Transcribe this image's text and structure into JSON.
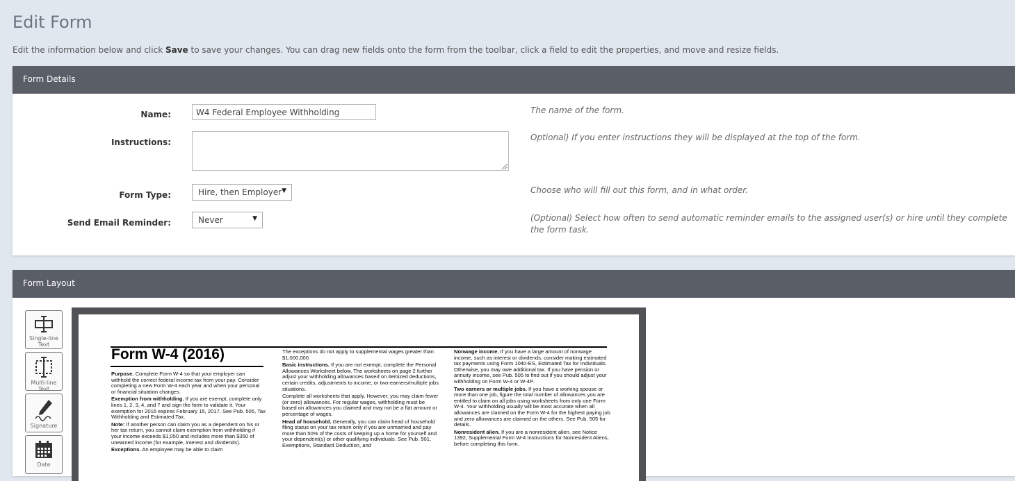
{
  "page": {
    "title": "Edit Form",
    "intro_before": "Edit the information below and click ",
    "intro_bold": "Save",
    "intro_after": " to save your changes. You can drag new fields onto the form from the toolbar, click a field to edit the properties, and move and resize fields."
  },
  "details": {
    "header": "Form Details",
    "name_label": "Name:",
    "name_value": "W4 Federal Employee Withholding",
    "name_help": "The name of the form.",
    "instructions_label": "Instructions:",
    "instructions_value": "",
    "instructions_help": "Optional) If you enter instructions they will be displayed at the top of the form.",
    "form_type_label": "Form Type:",
    "form_type_value": "Hire, then Employer",
    "form_type_help": "Choose who will fill out this form, and in what order.",
    "reminder_label": "Send Email Reminder:",
    "reminder_value": "Never",
    "reminder_help": "(Optional) Select how often to send automatic reminder emails to the assigned user(s) or hire until they complete the form task."
  },
  "layout": {
    "header": "Form Layout",
    "tools": [
      {
        "label_line1": "Single-line",
        "label_line2": "Text",
        "icon": "single-line-text-icon"
      },
      {
        "label_line1": "Multi-line",
        "label_line2": "Text",
        "icon": "multi-line-text-icon"
      },
      {
        "label_line1": "Signature",
        "label_line2": "",
        "icon": "signature-icon"
      },
      {
        "label_line1": "Date",
        "label_line2": "",
        "icon": "calendar-icon"
      }
    ]
  },
  "document": {
    "title": "Form W-4 (2016)",
    "col1": [
      {
        "bold": "Purpose.",
        "text": " Complete Form W-4 so that your employer can withhold the correct federal income tax from your pay. Consider completing a new Form W-4 each year and when your personal or financial situation changes."
      },
      {
        "bold": "Exemption from withholding.",
        "text": " If you are exempt, complete only lines 1, 2, 3, 4, and 7 and sign the form to validate it. Your exemption for 2016 expires February 15, 2017. See Pub. 505, Tax Withholding and Estimated Tax."
      },
      {
        "bold": "Note:",
        "text": " If another person can claim you as a dependent on his or her tax return, you cannot claim exemption from withholding if your income exceeds $1,050 and includes more than $350 of unearned income (for example, interest and dividends)."
      },
      {
        "bold": "Exceptions.",
        "text": " An employee may be able to claim"
      }
    ],
    "col2": [
      {
        "bold": "",
        "text": "The exceptions do not apply to supplemental wages greater than $1,000,000."
      },
      {
        "bold": "Basic instructions.",
        "text": " If you are not exempt, complete the Personal Allowances Worksheet below. The worksheets on page 2 further adjust your withholding allowances based on itemized deductions, certain credits, adjustments to income, or two-earners/multiple jobs situations."
      },
      {
        "bold": "",
        "text": "Complete all worksheets that apply. However, you may claim fewer (or zero) allowances. For regular wages, withholding must be based on allowances you claimed and may not be a flat amount or percentage of wages."
      },
      {
        "bold": "Head of household.",
        "text": " Generally, you can claim head of household filing status on your tax return only if you are unmarried and pay more than 50% of the costs of keeping up a home for yourself and your dependent(s) or other qualifying individuals. See Pub. 501, Exemptions, Standard Deduction, and"
      }
    ],
    "col3": [
      {
        "bold": "Nonwage income.",
        "text": " If you have a large amount of nonwage income, such as interest or dividends, consider making estimated tax payments using Form 1040-ES, Estimated Tax for Individuals. Otherwise, you may owe additional tax. If you have pension or annuity income, see Pub. 505 to find out if you should adjust your withholding on Form W-4 or W-4P."
      },
      {
        "bold": "Two earners or multiple jobs.",
        "text": " If you have a working spouse or more than one job, figure the total number of allowances you are entitled to claim on all jobs using worksheets from only one Form W-4. Your withholding usually will be most accurate when all allowances are claimed on the Form W-4 for the highest paying job and zero allowances are claimed on the others. See Pub. 505 for details."
      },
      {
        "bold": "Nonresident alien.",
        "text": " If you are a nonresident alien, see Notice 1392, Supplemental Form W-4 Instructions for Nonresident Aliens, before completing this form."
      }
    ]
  }
}
